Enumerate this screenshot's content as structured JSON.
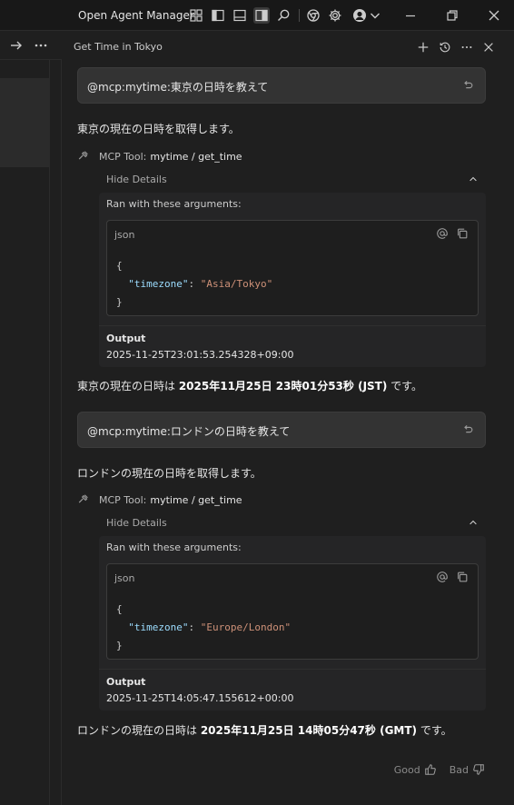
{
  "titlebar": {
    "app_title": "Open Agent Manager"
  },
  "panel": {
    "title": "Get Time in Tokyo"
  },
  "exchanges": [
    {
      "user_message": "@mcp:mytime:東京の日時を教えて",
      "intro": "東京の現在の日時を取得します。",
      "tool_prefix": "MCP Tool:",
      "tool_name": "mytime / get_time",
      "hide_details": "Hide Details",
      "args_label": "Ran with these arguments:",
      "code_lang": "json",
      "arg_key": "\"timezone\"",
      "arg_value": "\"Asia/Tokyo\"",
      "output_label": "Output",
      "output_value": "2025-11-25T23:01:53.254328+09:00",
      "answer_prefix": "東京の現在の日時は ",
      "answer_bold": "2025年11月25日 23時01分53秒 (JST)",
      "answer_suffix": " です。"
    },
    {
      "user_message": "@mcp:mytime:ロンドンの日時を教えて",
      "intro": "ロンドンの現在の日時を取得します。",
      "tool_prefix": "MCP Tool:",
      "tool_name": "mytime / get_time",
      "hide_details": "Hide Details",
      "args_label": "Ran with these arguments:",
      "code_lang": "json",
      "arg_key": "\"timezone\"",
      "arg_value": "\"Europe/London\"",
      "output_label": "Output",
      "output_value": "2025-11-25T14:05:47.155612+00:00",
      "answer_prefix": "ロンドンの現在の日時は ",
      "answer_bold": "2025年11月25日 14時05分47秒 (GMT)",
      "answer_suffix": " です。"
    }
  ],
  "feedback": {
    "good": "Good",
    "bad": "Bad"
  },
  "colors": {
    "background": "#1f1f1f",
    "titlebar": "#181818",
    "bubble": "#333333",
    "json_key": "#9cdcfe",
    "json_string": "#ce9178"
  }
}
